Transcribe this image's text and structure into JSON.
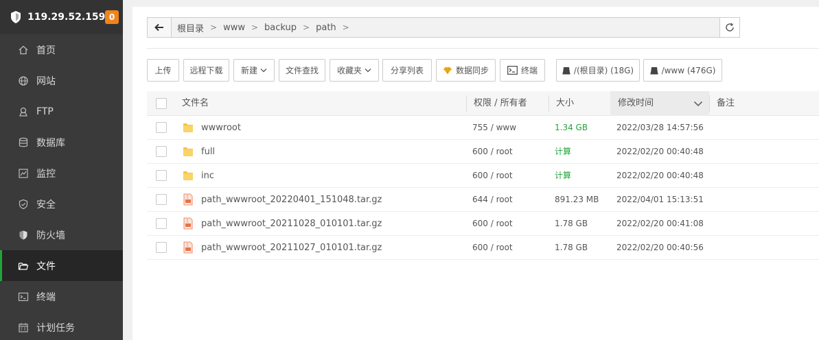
{
  "server": {
    "ip": "119.29.52.159",
    "badge": "0"
  },
  "sidebar": {
    "items": [
      {
        "label": "首页",
        "icon": "home-icon"
      },
      {
        "label": "网站",
        "icon": "globe-icon"
      },
      {
        "label": "FTP",
        "icon": "ftp-icon"
      },
      {
        "label": "数据库",
        "icon": "database-icon"
      },
      {
        "label": "监控",
        "icon": "monitor-icon"
      },
      {
        "label": "安全",
        "icon": "shield-check-icon"
      },
      {
        "label": "防火墙",
        "icon": "firewall-icon"
      },
      {
        "label": "文件",
        "icon": "folder-icon",
        "active": true
      },
      {
        "label": "终端",
        "icon": "terminal-icon"
      },
      {
        "label": "计划任务",
        "icon": "calendar-icon"
      }
    ]
  },
  "path": {
    "crumbs": [
      "根目录",
      "www",
      "backup",
      "path"
    ]
  },
  "toolbar": {
    "upload": "上传",
    "remote_download": "远程下载",
    "new": "新建",
    "file_search": "文件查找",
    "favorites": "收藏夹",
    "share_list": "分享列表",
    "data_sync": "数据同步",
    "terminal": "终端",
    "disk_root": "/(根目录) (18G)",
    "disk_www": "/www (476G)"
  },
  "table": {
    "headers": {
      "name": "文件名",
      "perm": "权限 / 所有者",
      "size": "大小",
      "mtime": "修改时间",
      "note": "备注"
    },
    "rows": [
      {
        "name": "wwwroot",
        "type": "folder",
        "perm": "755 / www",
        "size": "1.34 GB",
        "size_color": "green",
        "mtime": "2022/03/28 14:57:56"
      },
      {
        "name": "full",
        "type": "folder",
        "perm": "600 / root",
        "size": "计算",
        "size_color": "green",
        "mtime": "2022/02/20 00:40:48"
      },
      {
        "name": "inc",
        "type": "folder",
        "perm": "600 / root",
        "size": "计算",
        "size_color": "green",
        "mtime": "2022/02/20 00:40:48"
      },
      {
        "name": "path_wwwroot_20220401_151048.tar.gz",
        "type": "archive",
        "perm": "644 / root",
        "size": "891.23 MB",
        "size_color": "gray",
        "mtime": "2022/04/01 15:13:51"
      },
      {
        "name": "path_wwwroot_20211028_010101.tar.gz",
        "type": "archive",
        "perm": "600 / root",
        "size": "1.78 GB",
        "size_color": "gray",
        "mtime": "2022/02/20 00:41:08"
      },
      {
        "name": "path_wwwroot_20211027_010101.tar.gz",
        "type": "archive",
        "perm": "600 / root",
        "size": "1.78 GB",
        "size_color": "gray",
        "mtime": "2022/02/20 00:40:56"
      }
    ]
  },
  "colors": {
    "accent": "#20a53a",
    "badge": "#f0841c",
    "sidebar_bg": "#3a3a3a",
    "folder": "#f6c342",
    "archive": "#e8734a"
  }
}
